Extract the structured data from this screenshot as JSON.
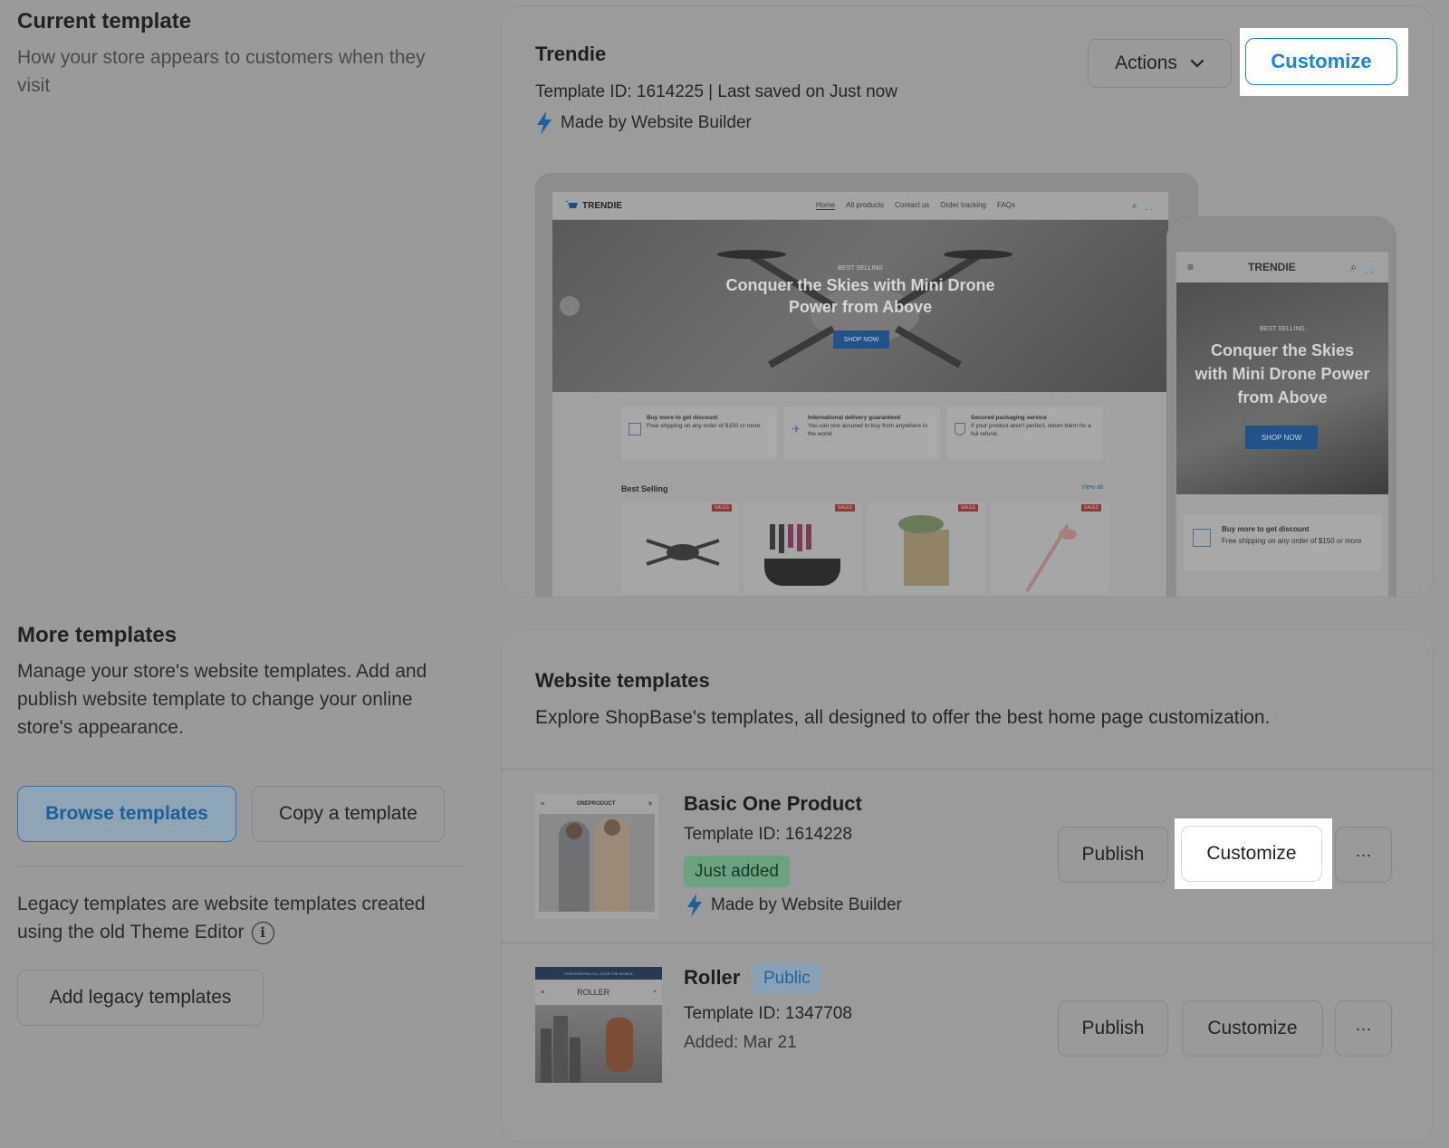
{
  "current_template": {
    "section_title": "Current template",
    "section_desc": "How your store appears to customers when they visit",
    "name": "Trendie",
    "meta": "Template ID: 1614225 | Last saved on Just now",
    "made_by": "Made by Website Builder",
    "actions_label": "Actions",
    "customize_label": "Customize",
    "preview": {
      "logo": "TRENDIE",
      "nav": [
        "Home",
        "All products",
        "Contact us",
        "Order tracking",
        "FAQs"
      ],
      "hero_kicker": "BEST SELLING",
      "hero_title": "Conquer the Skies with Mini Drone Power from Above",
      "hero_cta": "SHOP NOW",
      "features": [
        {
          "title": "Buy more to get discount",
          "desc": "Free shipping on any order of $150 or more."
        },
        {
          "title": "International delivery guaranteed",
          "desc": "You can rest assured to buy from anywhere in the world."
        },
        {
          "title": "Secured packaging service",
          "desc": "If your product aren't perfect, return them for a full refund."
        }
      ],
      "best_selling": "Best Selling",
      "view_all": "View all",
      "sale_tag": "SALES",
      "mobile_feature_title": "Buy more to get discount",
      "mobile_feature_desc": "Free shipping on any order of $150 or more"
    }
  },
  "more_templates": {
    "title": "More templates",
    "desc": "Manage your store's website templates. Add and publish website template to change your online store's appearance.",
    "browse_label": "Browse templates",
    "copy_label": "Copy a template",
    "legacy_desc": "Legacy templates are website templates created using the old Theme Editor",
    "info_glyph": "i",
    "add_legacy_label": "Add legacy templates"
  },
  "website_templates": {
    "title": "Website templates",
    "desc": "Explore ShopBase's templates, all designed to offer the best home page customization.",
    "items": [
      {
        "name": "Basic One Product",
        "template_id": "Template ID: 1614228",
        "badge": "Just added",
        "made_by": "Made by Website Builder",
        "thumb_logo": "ONEPRODUCT",
        "publish_label": "Publish",
        "customize_label": "Customize",
        "more_label": "···"
      },
      {
        "name": "Roller",
        "badge": "Public",
        "template_id": "Template ID: 1347708",
        "added": "Added: Mar 21",
        "thumb_logo": "ROLLER",
        "thumb_banner": "FREESHIPPING ALL OVER THE WORLD",
        "publish_label": "Publish",
        "customize_label": "Customize",
        "more_label": "···"
      }
    ]
  },
  "colors": {
    "overlay_gray": "#9a9a9a",
    "accent_blue": "#1883e0",
    "badge_green": "#6ca27f",
    "bolt_blue": "#1f5fa0"
  }
}
